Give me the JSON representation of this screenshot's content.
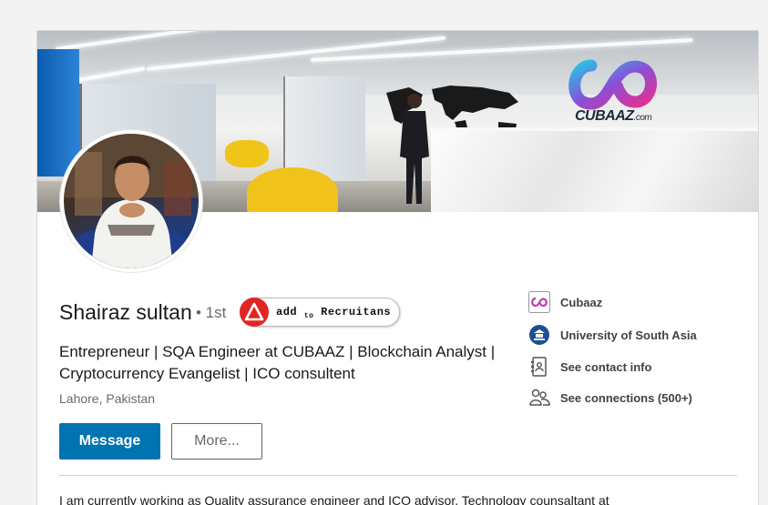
{
  "profile": {
    "name": "Shairaz sultan",
    "degree": "• 1st",
    "headline": "Entrepreneur | SQA Engineer at CUBAAZ | Blockchain Analyst | Cryptocurrency Evangelist | ICO consultent",
    "location": "Lahore, Pakistan",
    "summary": "I am currently working as Quality assurance engineer and ICO advisor, Technology counsaltant at"
  },
  "banner": {
    "logo_text": "CUBAAZ",
    "logo_suffix": ".com"
  },
  "recruit_badge": {
    "word1": "add",
    "word2": "to",
    "word3": "Recruitans"
  },
  "actions": {
    "message_label": "Message",
    "more_label": "More..."
  },
  "sidebar": {
    "items": [
      {
        "label": "Cubaaz",
        "icon": "company-logo-icon"
      },
      {
        "label": "University of South Asia",
        "icon": "university-logo-icon"
      },
      {
        "label": "See contact info",
        "icon": "contact-card-icon"
      },
      {
        "label": "See connections (500+)",
        "icon": "people-icon"
      }
    ]
  },
  "colors": {
    "primary": "#0073b1",
    "badge_red": "#e02525"
  }
}
